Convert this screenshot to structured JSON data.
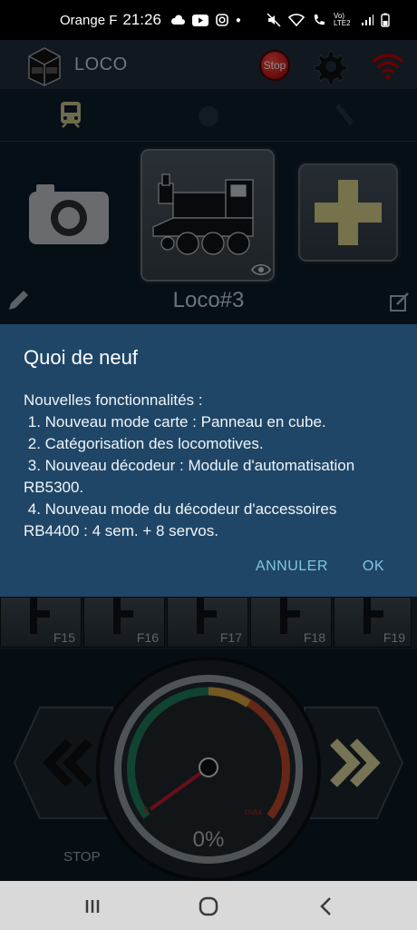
{
  "status": {
    "carrier": "Orange F",
    "time": "21:26",
    "volte": "Vo) LTE2"
  },
  "header": {
    "app_title": "LOCO",
    "stop_label": "Stop"
  },
  "loco": {
    "name": "Loco#3"
  },
  "function_keys": [
    "F15",
    "F16",
    "F17",
    "F18",
    "F19"
  ],
  "throttle": {
    "percent": "0%",
    "stop_label": "STOP",
    "gauge_min": "0",
    "gauge_max": "max"
  },
  "dialog": {
    "title": "Quoi de neuf",
    "body": "Nouvelles fonctionnalités :\n 1. Nouveau mode carte : Panneau en cube.\n 2. Catégorisation des locomotives.\n 3. Nouveau décodeur : Module d'automatisation RB5300.\n 4. Nouveau mode du décodeur d'accessoires RB4400 : 4 sem. + 8 servos.",
    "cancel_label": "ANNULER",
    "ok_label": "OK"
  },
  "colors": {
    "dialog_bg": "#1f4667",
    "accent": "#7fc6e6",
    "stop_red": "#d10000",
    "plus_yellow": "#d8d08a"
  }
}
